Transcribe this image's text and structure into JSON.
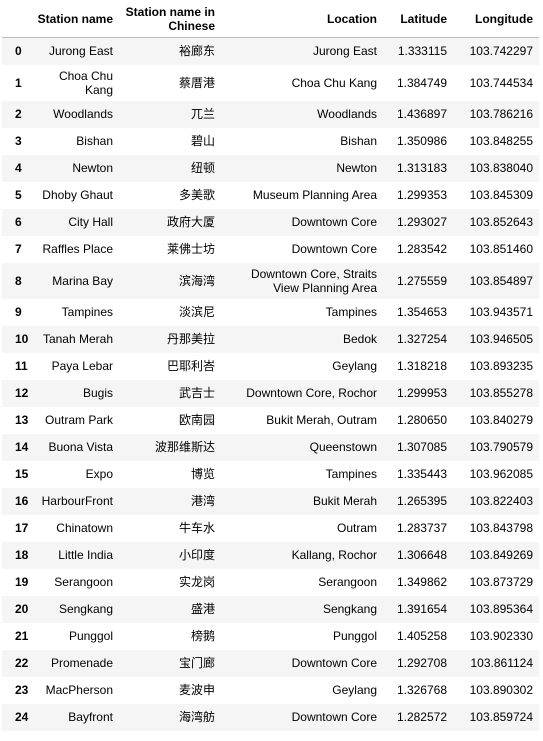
{
  "columns": {
    "index": "",
    "station_name": "Station name",
    "station_name_cn": "Station name in Chinese",
    "location": "Location",
    "latitude": "Latitude",
    "longitude": "Longitude"
  },
  "rows": [
    {
      "idx": "0",
      "name": "Jurong East",
      "cn": "裕廊东",
      "loc": "Jurong East",
      "lat": "1.333115",
      "lon": "103.742297"
    },
    {
      "idx": "1",
      "name": "Choa Chu Kang",
      "cn": "蔡厝港",
      "loc": "Choa Chu Kang",
      "lat": "1.384749",
      "lon": "103.744534"
    },
    {
      "idx": "2",
      "name": "Woodlands",
      "cn": "兀兰",
      "loc": "Woodlands",
      "lat": "1.436897",
      "lon": "103.786216"
    },
    {
      "idx": "3",
      "name": "Bishan",
      "cn": "碧山",
      "loc": "Bishan",
      "lat": "1.350986",
      "lon": "103.848255"
    },
    {
      "idx": "4",
      "name": "Newton",
      "cn": "纽顿",
      "loc": "Newton",
      "lat": "1.313183",
      "lon": "103.838040"
    },
    {
      "idx": "5",
      "name": "Dhoby Ghaut",
      "cn": "多美歌",
      "loc": "Museum Planning Area",
      "lat": "1.299353",
      "lon": "103.845309"
    },
    {
      "idx": "6",
      "name": "City Hall",
      "cn": "政府大厦",
      "loc": "Downtown Core",
      "lat": "1.293027",
      "lon": "103.852643"
    },
    {
      "idx": "7",
      "name": "Raffles Place",
      "cn": "莱佛士坊",
      "loc": "Downtown Core",
      "lat": "1.283542",
      "lon": "103.851460"
    },
    {
      "idx": "8",
      "name": "Marina Bay",
      "cn": "滨海湾",
      "loc": "Downtown Core, Straits View Planning Area",
      "lat": "1.275559",
      "lon": "103.854897"
    },
    {
      "idx": "9",
      "name": "Tampines",
      "cn": "淡滨尼",
      "loc": "Tampines",
      "lat": "1.354653",
      "lon": "103.943571"
    },
    {
      "idx": "10",
      "name": "Tanah Merah",
      "cn": "丹那美拉",
      "loc": "Bedok",
      "lat": "1.327254",
      "lon": "103.946505"
    },
    {
      "idx": "11",
      "name": "Paya Lebar",
      "cn": "巴耶利峇",
      "loc": "Geylang",
      "lat": "1.318218",
      "lon": "103.893235"
    },
    {
      "idx": "12",
      "name": "Bugis",
      "cn": "武吉士",
      "loc": "Downtown Core, Rochor",
      "lat": "1.299953",
      "lon": "103.855278"
    },
    {
      "idx": "13",
      "name": "Outram Park",
      "cn": "欧南园",
      "loc": "Bukit Merah, Outram",
      "lat": "1.280650",
      "lon": "103.840279"
    },
    {
      "idx": "14",
      "name": "Buona Vista",
      "cn": "波那维斯达",
      "loc": "Queenstown",
      "lat": "1.307085",
      "lon": "103.790579"
    },
    {
      "idx": "15",
      "name": "Expo",
      "cn": "博览",
      "loc": "Tampines",
      "lat": "1.335443",
      "lon": "103.962085"
    },
    {
      "idx": "16",
      "name": "HarbourFront",
      "cn": "港湾",
      "loc": "Bukit Merah",
      "lat": "1.265395",
      "lon": "103.822403"
    },
    {
      "idx": "17",
      "name": "Chinatown",
      "cn": "牛车水",
      "loc": "Outram",
      "lat": "1.283737",
      "lon": "103.843798"
    },
    {
      "idx": "18",
      "name": "Little India",
      "cn": "小印度",
      "loc": "Kallang, Rochor",
      "lat": "1.306648",
      "lon": "103.849269"
    },
    {
      "idx": "19",
      "name": "Serangoon",
      "cn": "实龙岗",
      "loc": "Serangoon",
      "lat": "1.349862",
      "lon": "103.873729"
    },
    {
      "idx": "20",
      "name": "Sengkang",
      "cn": "盛港",
      "loc": "Sengkang",
      "lat": "1.391654",
      "lon": "103.895364"
    },
    {
      "idx": "21",
      "name": "Punggol",
      "cn": "榜鹅",
      "loc": "Punggol",
      "lat": "1.405258",
      "lon": "103.902330"
    },
    {
      "idx": "22",
      "name": "Promenade",
      "cn": "宝门廊",
      "loc": "Downtown Core",
      "lat": "1.292708",
      "lon": "103.861124"
    },
    {
      "idx": "23",
      "name": "MacPherson",
      "cn": "麦波申",
      "loc": "Geylang",
      "lat": "1.326768",
      "lon": "103.890302"
    },
    {
      "idx": "24",
      "name": "Bayfront",
      "cn": "海湾舫",
      "loc": "Downtown Core",
      "lat": "1.282572",
      "lon": "103.859724"
    }
  ]
}
